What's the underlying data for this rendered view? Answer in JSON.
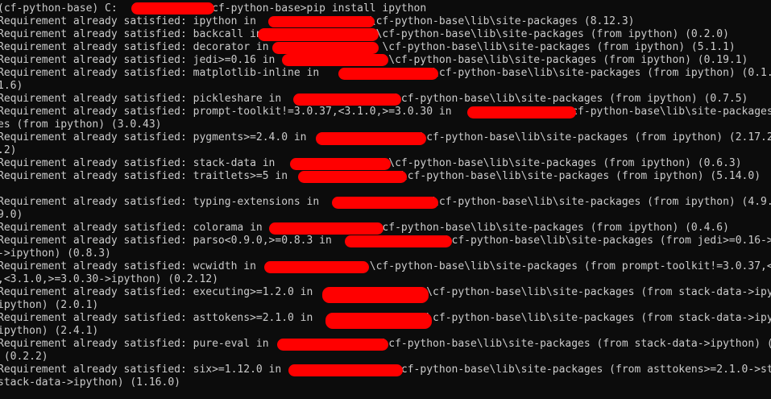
{
  "terminal": {
    "background_color": "#0c0c0c",
    "text_color": "#cccccc",
    "redaction_color": "#ff0000",
    "lines": [
      "(cf-python-base) C:              \\cf-python-base>pip install ipython",
      "Requirement already satisfied: ipython in                  \\cf-python-base\\lib\\site-packages (8.12.3)",
      "Requirement already satisfied: backcall in                  \\cf-python-base\\lib\\site-packages (from ipython) (0.2.0)",
      "Requirement already satisfied: decorator in                  \\cf-python-base\\lib\\site-packages (from ipython) (5.1.1)",
      "Requirement already satisfied: jedi>=0.16 in                  \\cf-python-base\\lib\\site-packages (from ipython) (0.19.1)",
      "Requirement already satisfied: matplotlib-inline in                  \\cf-python-base\\lib\\site-packages (from ipython) (0.1.6)",
      "1.6)",
      "Requirement already satisfied: pickleshare in                  \\cf-python-base\\lib\\site-packages (from ipython) (0.7.5)",
      "Requirement already satisfied: prompt-toolkit!=3.0.37,<3.1.0,>=3.0.30 in                  \\cf-python-base\\lib\\site-packages (from ipython) (3.0.43)",
      "es (from ipython) (3.0.43)",
      "Requirement already satisfied: pygments>=2.4.0 in                  \\cf-python-base\\lib\\site-packages (from ipython) (2.17.2)",
      ".2)",
      "Requirement already satisfied: stack-data in                  \\cf-python-base\\lib\\site-packages (from ipython) (0.6.3)",
      "Requirement already satisfied: traitlets>=5 in                  \\cf-python-base\\lib\\site-packages (from ipython) (5.14.0)",
      "",
      "Requirement already satisfied: typing-extensions in                  \\cf-python-base\\lib\\site-packages (from ipython) (4.9.0)",
      "9.0)",
      "Requirement already satisfied: colorama in                  \\cf-python-base\\lib\\site-packages (from ipython) (0.4.6)",
      "Requirement already satisfied: parso<0.9.0,>=0.8.3 in                  \\cf-python-base\\lib\\site-packages (from jedi>=0.16->ipython) (0.8.3)",
      "->ipython) (0.8.3)",
      "Requirement already satisfied: wcwidth in                  \\cf-python-base\\lib\\site-packages (from prompt-toolkit!=3.0.37,<3.1.0,>=3.0.30->ipython) (0.2.12)",
      ",<3.1.0,>=3.0.30->ipython) (0.2.12)",
      "Requirement already satisfied: executing>=1.2.0 in                  \\cf-python-base\\lib\\site-packages (from stack-data->ipython) (2.0.1)",
      "ipython) (2.0.1)",
      "Requirement already satisfied: asttokens>=2.1.0 in                  \\cf-python-base\\lib\\site-packages (from stack-data->ipython) (2.4.1)",
      "ipython) (2.4.1)",
      "Requirement already satisfied: pure-eval in                  \\cf-python-base\\lib\\site-packages (from stack-data->ipython) (0.2.2)",
      " (0.2.2)",
      "Requirement already satisfied: six>=1.12.0 in                  \\cf-python-base\\lib\\site-packages (from asttokens>=2.1.0->stack-data->ipython) (1.16.0)",
      "stack-data->ipython) (1.16.0)"
    ]
  }
}
